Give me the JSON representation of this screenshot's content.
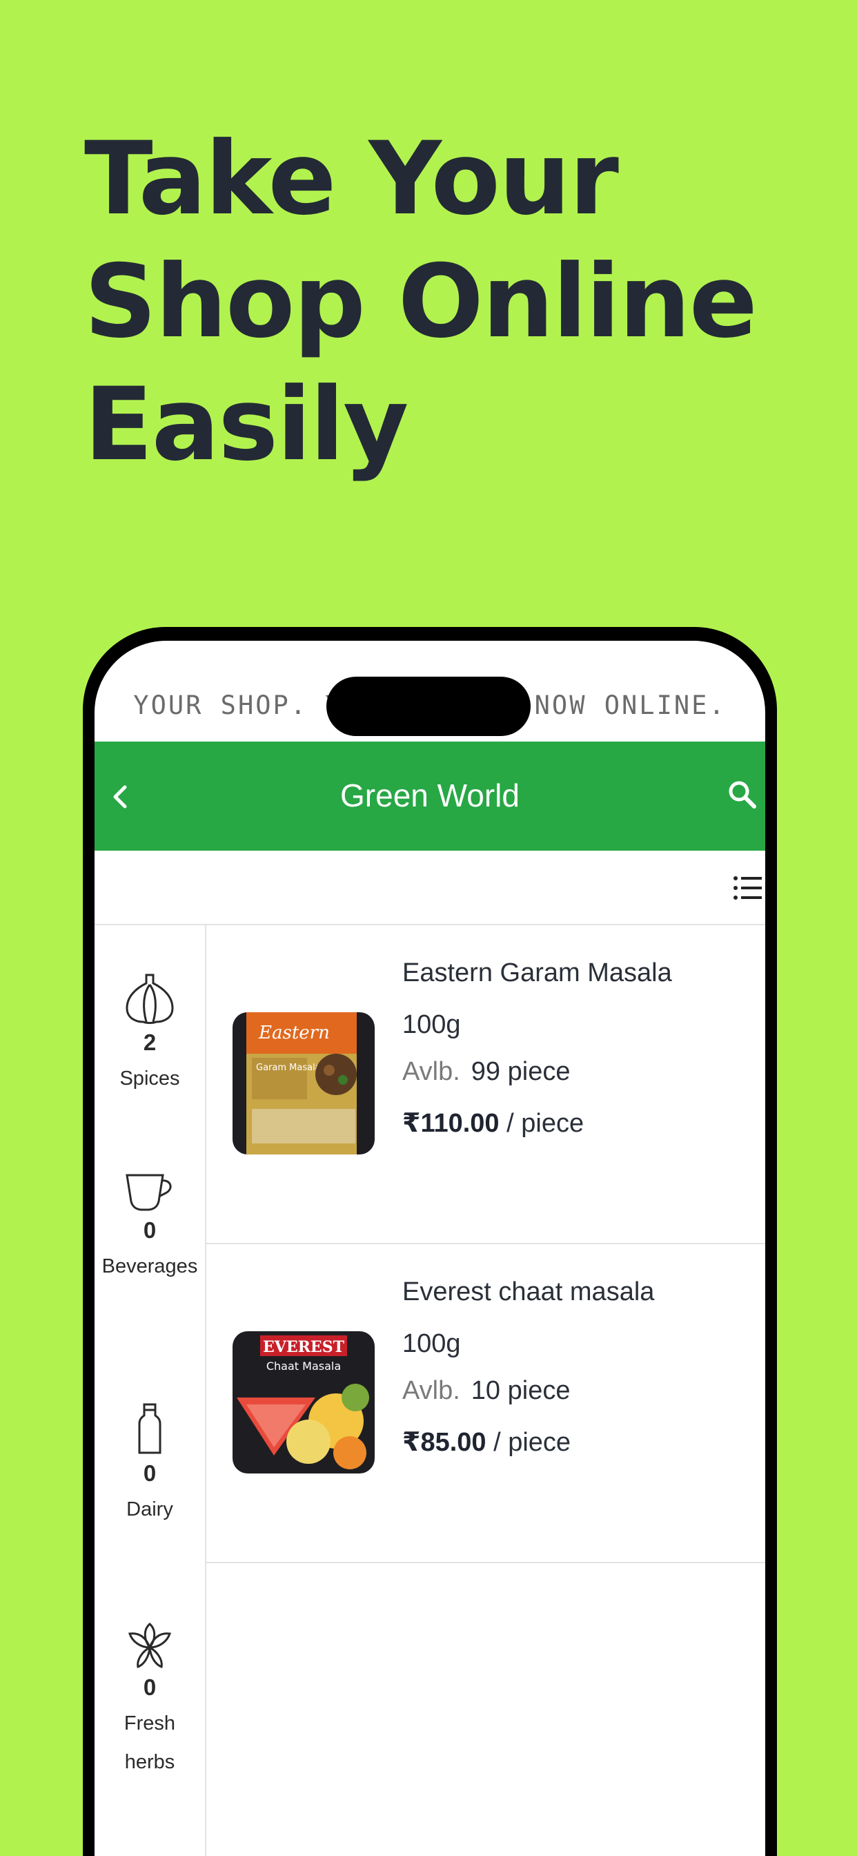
{
  "headline": {
    "line1": "Take Your",
    "line2": "Shop Online",
    "line3": "Easily"
  },
  "tagline": "YOUR SHOP. YOUR BRAND. NOW ONLINE.",
  "appbar": {
    "title": "Green World",
    "back_icon": "chevron-left-icon",
    "search_icon": "search-icon",
    "color": "#28a745"
  },
  "toolbar": {
    "view_icon": "list-view-icon"
  },
  "categories": [
    {
      "icon": "garlic-icon",
      "count": "2",
      "name": "Spices"
    },
    {
      "icon": "teacup-icon",
      "count": "0",
      "name": "Beverages"
    },
    {
      "icon": "milk-bottle-icon",
      "count": "0",
      "name": "Dairy"
    },
    {
      "icon": "herb-leaf-icon",
      "count": "0",
      "name_line1": "Fresh",
      "name_line2": "herbs"
    }
  ],
  "products": [
    {
      "name": "Eastern Garam Masala",
      "quantity": "100g",
      "avlb_label": "Avlb.",
      "stock": "99 piece",
      "price": "₹110.00",
      "unit": "/ piece",
      "image_brand": "Eastern",
      "image_label": "Garam Masala"
    },
    {
      "name": "Everest chaat masala",
      "quantity": "100g",
      "avlb_label": "Avlb.",
      "stock": "10 piece",
      "price": "₹85.00",
      "unit": "/ piece",
      "image_brand": "EVEREST",
      "image_label": "Chaat Masala"
    }
  ],
  "colors": {
    "background": "#b2f24f",
    "headline": "#232a35"
  }
}
